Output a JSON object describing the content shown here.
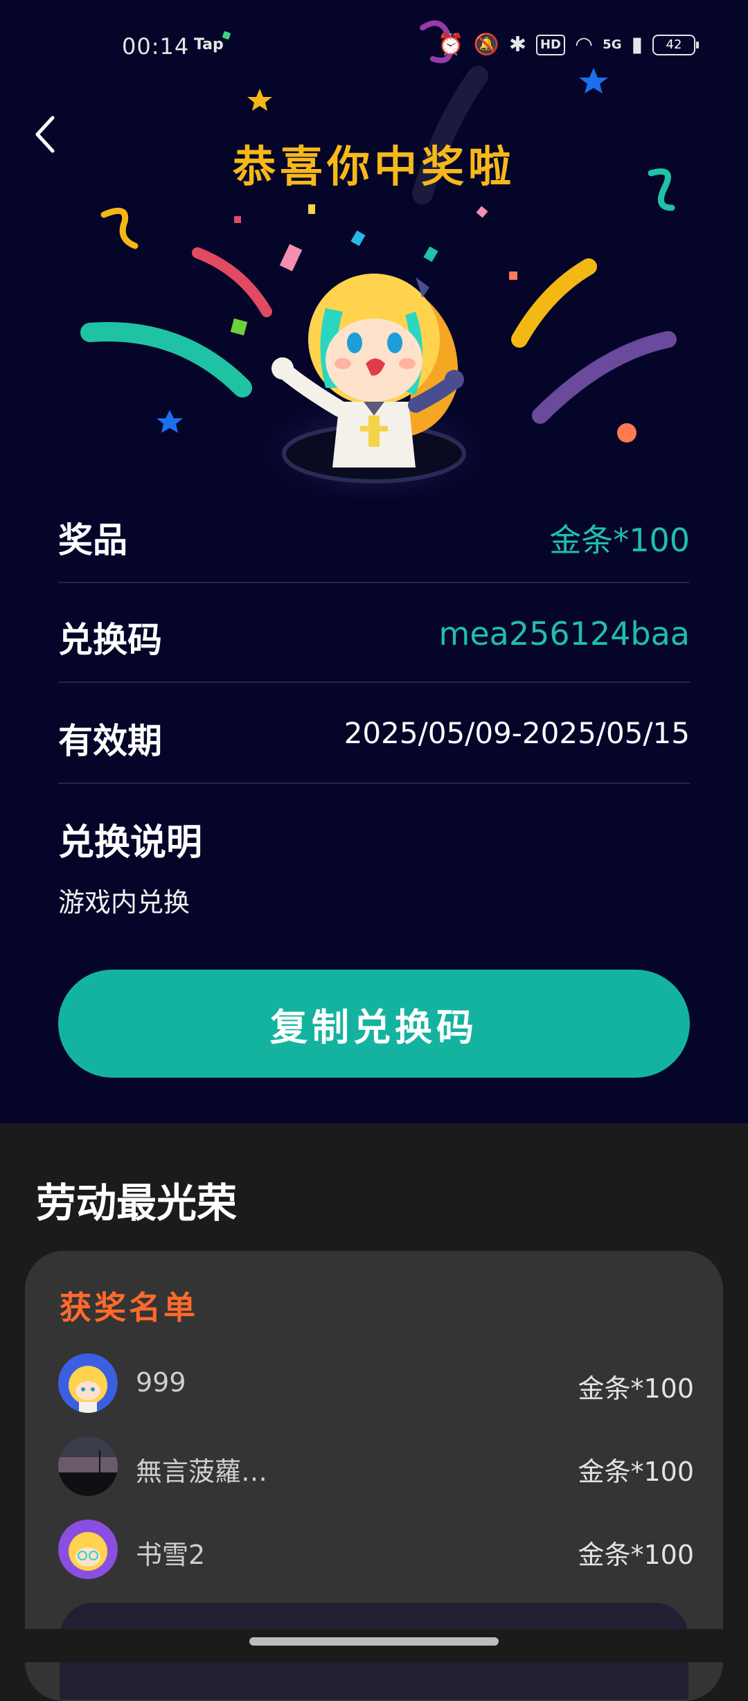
{
  "status_bar": {
    "time": "00:14",
    "tap_badge": "Tap",
    "network": "5G",
    "battery": "42",
    "hd": "HD"
  },
  "header": {
    "title": "恭喜你中奖啦"
  },
  "prize": {
    "prize_label": "奖品",
    "prize_value": "金条*100",
    "code_label": "兑换码",
    "code_value": "mea256124baa",
    "validity_label": "有效期",
    "validity_value": "2025/05/09-2025/05/15",
    "explain_label": "兑换说明",
    "explain_text": "游戏内兑换"
  },
  "copy_button_label": "复制兑换码",
  "event": {
    "title": "劳动最光荣",
    "winners_title": "获奖名单",
    "winners": [
      {
        "name": "999",
        "prize": "金条*100"
      },
      {
        "name": "無言菠蘿…",
        "prize": "金条*100"
      },
      {
        "name": "书雪2",
        "prize": "金条*100"
      }
    ]
  },
  "colors": {
    "bg_top": "#05052a",
    "accent_teal": "#14b3a0",
    "title_gold": "#f7b81a",
    "winners_title": "#ff6a2b",
    "card_bg": "#343434"
  },
  "icons": [
    "back-arrow-icon",
    "alarm-icon",
    "mute-icon",
    "bluetooth-icon",
    "wifi-icon",
    "signal-icon",
    "battery-icon"
  ]
}
